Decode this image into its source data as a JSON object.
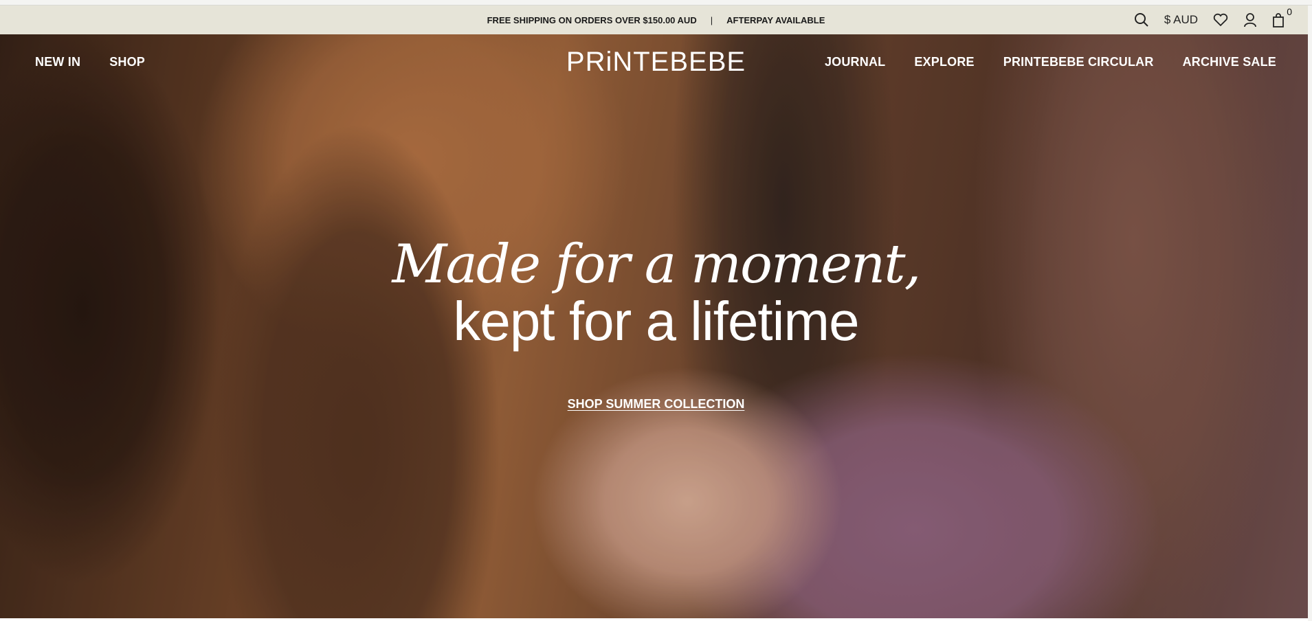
{
  "announcement": {
    "shipping_text": "FREE SHIPPING ON ORDERS OVER $150.00 AUD",
    "separator": "|",
    "afterpay_text": "AFTERPAY AVAILABLE"
  },
  "utility": {
    "currency": "$ AUD",
    "cart_count": "0",
    "icons": [
      "search-icon",
      "heart-icon",
      "user-icon",
      "bag-icon"
    ]
  },
  "header": {
    "logo": "PRiNTEBEBE",
    "nav_left": [
      "NEW IN",
      "SHOP"
    ],
    "nav_right": [
      "JOURNAL",
      "EXPLORE",
      "PRINTEBEBE CIRCULAR",
      "ARCHIVE SALE"
    ]
  },
  "hero": {
    "headline_line1": "Made for a moment,",
    "headline_line2": "kept for a lifetime",
    "cta": "SHOP SUMMER COLLECTION"
  },
  "colors": {
    "announcement_bg": "#e6e4d8",
    "text_dark": "#1a1a1a",
    "hero_text": "#ffffff"
  }
}
